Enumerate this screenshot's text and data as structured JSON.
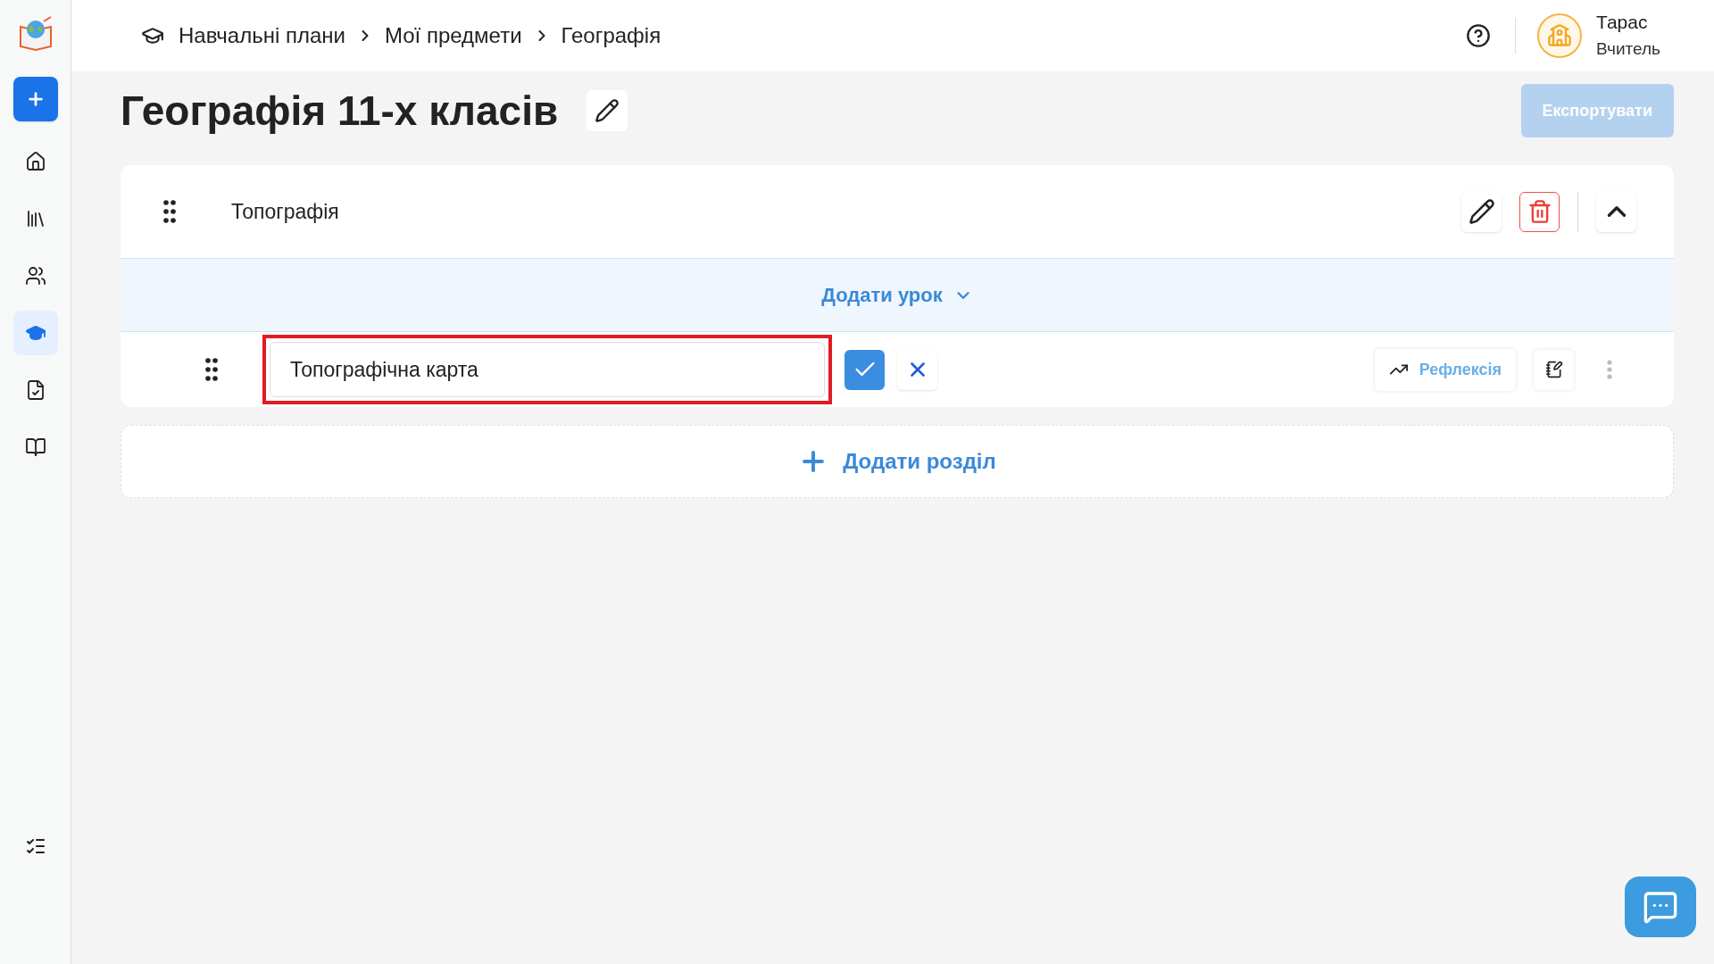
{
  "sidebar": {
    "items": [
      {
        "kind": "create",
        "selected": false
      },
      {
        "kind": "home",
        "selected": false
      },
      {
        "kind": "library",
        "selected": false
      },
      {
        "kind": "users",
        "selected": false
      },
      {
        "kind": "plans",
        "selected": true
      },
      {
        "kind": "tasks",
        "selected": false
      },
      {
        "kind": "journal",
        "selected": false
      }
    ]
  },
  "breadcrumbs": [
    "Навчальні плани",
    "Мої предмети",
    "Географія"
  ],
  "user": {
    "name": "Тарас",
    "role": "Вчитель"
  },
  "page_title": "Географія 11-х класів",
  "export_button": {
    "label": "Експортувати",
    "disabled": true
  },
  "section": {
    "title": "Топографія",
    "expanded": true
  },
  "add_lesson": {
    "label": "Додати урок"
  },
  "lessons": [
    {
      "value": "Топографічна карта",
      "highlighted": true,
      "reflection": "Рефлексія"
    }
  ],
  "add_section": {
    "label": "Додати розділ"
  }
}
